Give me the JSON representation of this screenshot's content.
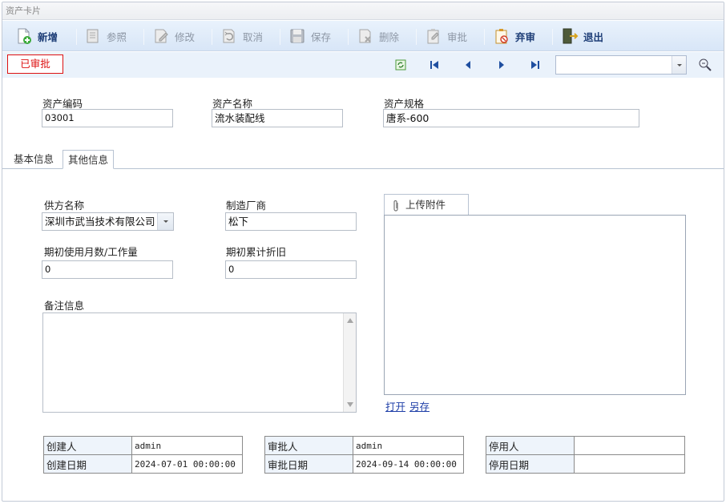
{
  "window": {
    "title": "资产卡片"
  },
  "toolbar": {
    "buttons": [
      {
        "label": "新增",
        "enabled": true
      },
      {
        "label": "参照",
        "enabled": false
      },
      {
        "label": "修改",
        "enabled": false
      },
      {
        "label": "取消",
        "enabled": false
      },
      {
        "label": "保存",
        "enabled": false
      },
      {
        "label": "删除",
        "enabled": false
      },
      {
        "label": "审批",
        "enabled": false
      },
      {
        "label": "弃审",
        "enabled": true
      },
      {
        "label": "退出",
        "enabled": true
      }
    ]
  },
  "status_badge": "已审批",
  "nav": {
    "search_value": ""
  },
  "header": {
    "asset_code": {
      "label": "资产编码",
      "value": "03001"
    },
    "asset_name": {
      "label": "资产名称",
      "value": "流水装配线"
    },
    "asset_spec": {
      "label": "资产规格",
      "value": "唐系-600"
    }
  },
  "tabs": [
    {
      "label": "基本信息",
      "active": false
    },
    {
      "label": "其他信息",
      "active": true
    }
  ],
  "other": {
    "supplier": {
      "label": "供方名称",
      "value": "深圳市武当技术有限公司"
    },
    "manufacturer": {
      "label": "制造厂商",
      "value": "松下"
    },
    "initial_months": {
      "label": "期初使用月数/工作量",
      "value": "0"
    },
    "initial_depreciation": {
      "label": "期初累计折旧",
      "value": "0"
    },
    "remarks": {
      "label": "备注信息",
      "value": ""
    }
  },
  "attachments": {
    "tab_label": "上传附件",
    "open_link": "打开",
    "save_as_link": "另存"
  },
  "audit": {
    "creator": {
      "label": "创建人",
      "value": "admin"
    },
    "created_date": {
      "label": "创建日期",
      "value": "2024-07-01 00:00:00"
    },
    "approver": {
      "label": "审批人",
      "value": "admin"
    },
    "approved_date": {
      "label": "审批日期",
      "value": "2024-09-14 00:00:00"
    },
    "disabler": {
      "label": "停用人",
      "value": ""
    },
    "disabled_date": {
      "label": "停用日期",
      "value": ""
    }
  },
  "colors": {
    "accent": "#1f3f78",
    "status_red": "#dd1111",
    "toolbar_bg": "#dde9f8"
  }
}
